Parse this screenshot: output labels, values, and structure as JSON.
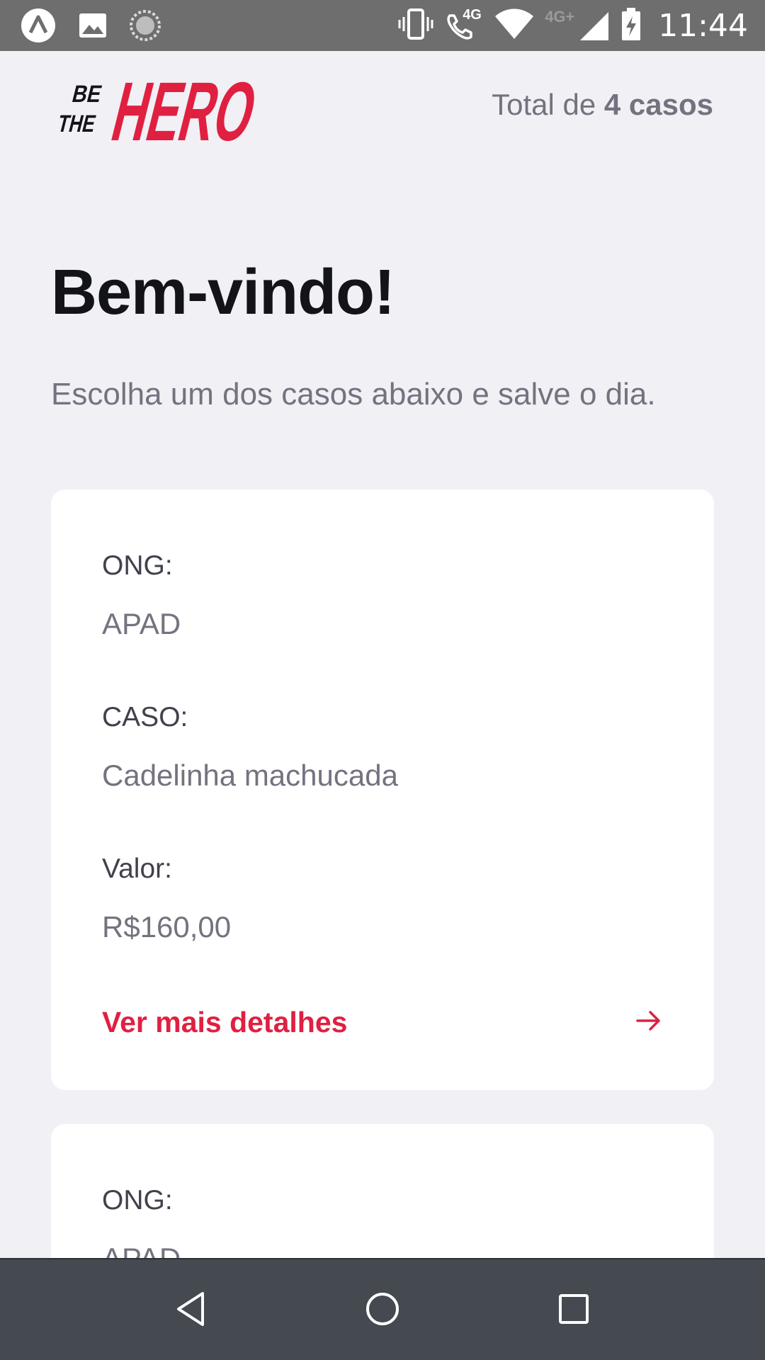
{
  "status_bar": {
    "time": "11:44",
    "network_4g": "4G",
    "network_4g_plus": "4G+",
    "icons": [
      "app-notification-icon",
      "image-notification-icon",
      "sync-notification-icon",
      "vibrate-icon",
      "wifi-calling-icon",
      "wifi-icon",
      "signal-icon",
      "battery-charging-icon"
    ]
  },
  "header": {
    "logo_alt": "BE THE HERO",
    "logo_line1": "BE",
    "logo_line2": "THE",
    "logo_word": "HERO",
    "total_prefix": "Total de",
    "total_count": "4 casos"
  },
  "page": {
    "title": "Bem-vindo!",
    "description": "Escolha um dos casos abaixo e salve o dia."
  },
  "incidents": [
    {
      "ong_label": "ONG:",
      "ong_value": "APAD",
      "case_label": "CASO:",
      "case_value": "Cadelinha machucada",
      "value_label": "Valor:",
      "value_value": "R$160,00",
      "details_label": "Ver mais detalhes"
    },
    {
      "ong_label": "ONG:",
      "ong_value": "APAD"
    }
  ],
  "colors": {
    "brand_red": "#e02041",
    "background": "#f0f0f5",
    "title": "#13131a",
    "muted": "#737380",
    "label": "#41414d",
    "status_bar": "#6e6e6e",
    "nav_bar": "#454a50"
  },
  "nav_bar": {
    "icons": [
      "back-icon",
      "home-icon",
      "recents-icon"
    ]
  }
}
